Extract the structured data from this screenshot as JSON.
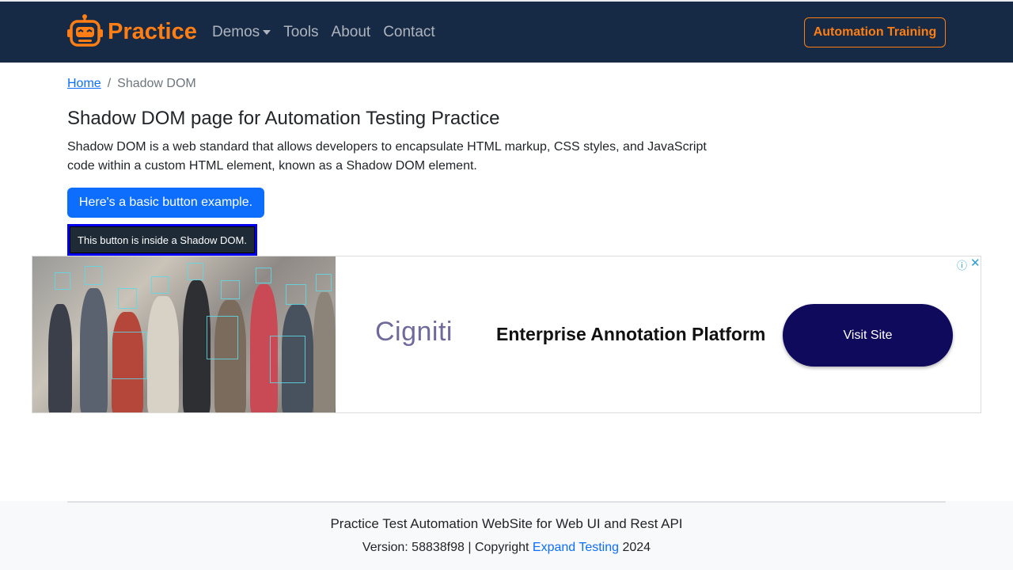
{
  "navbar": {
    "brand": "Practice",
    "links": [
      "Demos",
      "Tools",
      "About",
      "Contact"
    ],
    "cta": "Automation Training"
  },
  "breadcrumb": {
    "home": "Home",
    "separator": "/",
    "current": "Shadow DOM"
  },
  "main": {
    "title": "Shadow DOM page for Automation Testing Practice",
    "description": "Shadow DOM is a web standard that allows developers to encapsulate HTML markup, CSS styles, and JavaScript code within a custom HTML element, known as a Shadow DOM element.",
    "basic_button": "Here's a basic button example.",
    "shadow_button": "This button is inside a Shadow DOM."
  },
  "ad": {
    "logo": "Cigniti",
    "headline": "Enterprise Annotation Platform",
    "cta": "Visit Site",
    "info_icon": "ⓘ",
    "close_icon": "✕"
  },
  "footer": {
    "title": "Practice Test Automation WebSite for Web UI and Rest API",
    "version_prefix": "Version: 58838f98 | Copyright ",
    "company": "Expand Testing",
    "year": " 2024"
  },
  "colors": {
    "navbar_bg": "#172a45",
    "brand_orange": "#fd7e14",
    "primary": "#0d6efd",
    "ad_cta": "#0f0a5c"
  }
}
